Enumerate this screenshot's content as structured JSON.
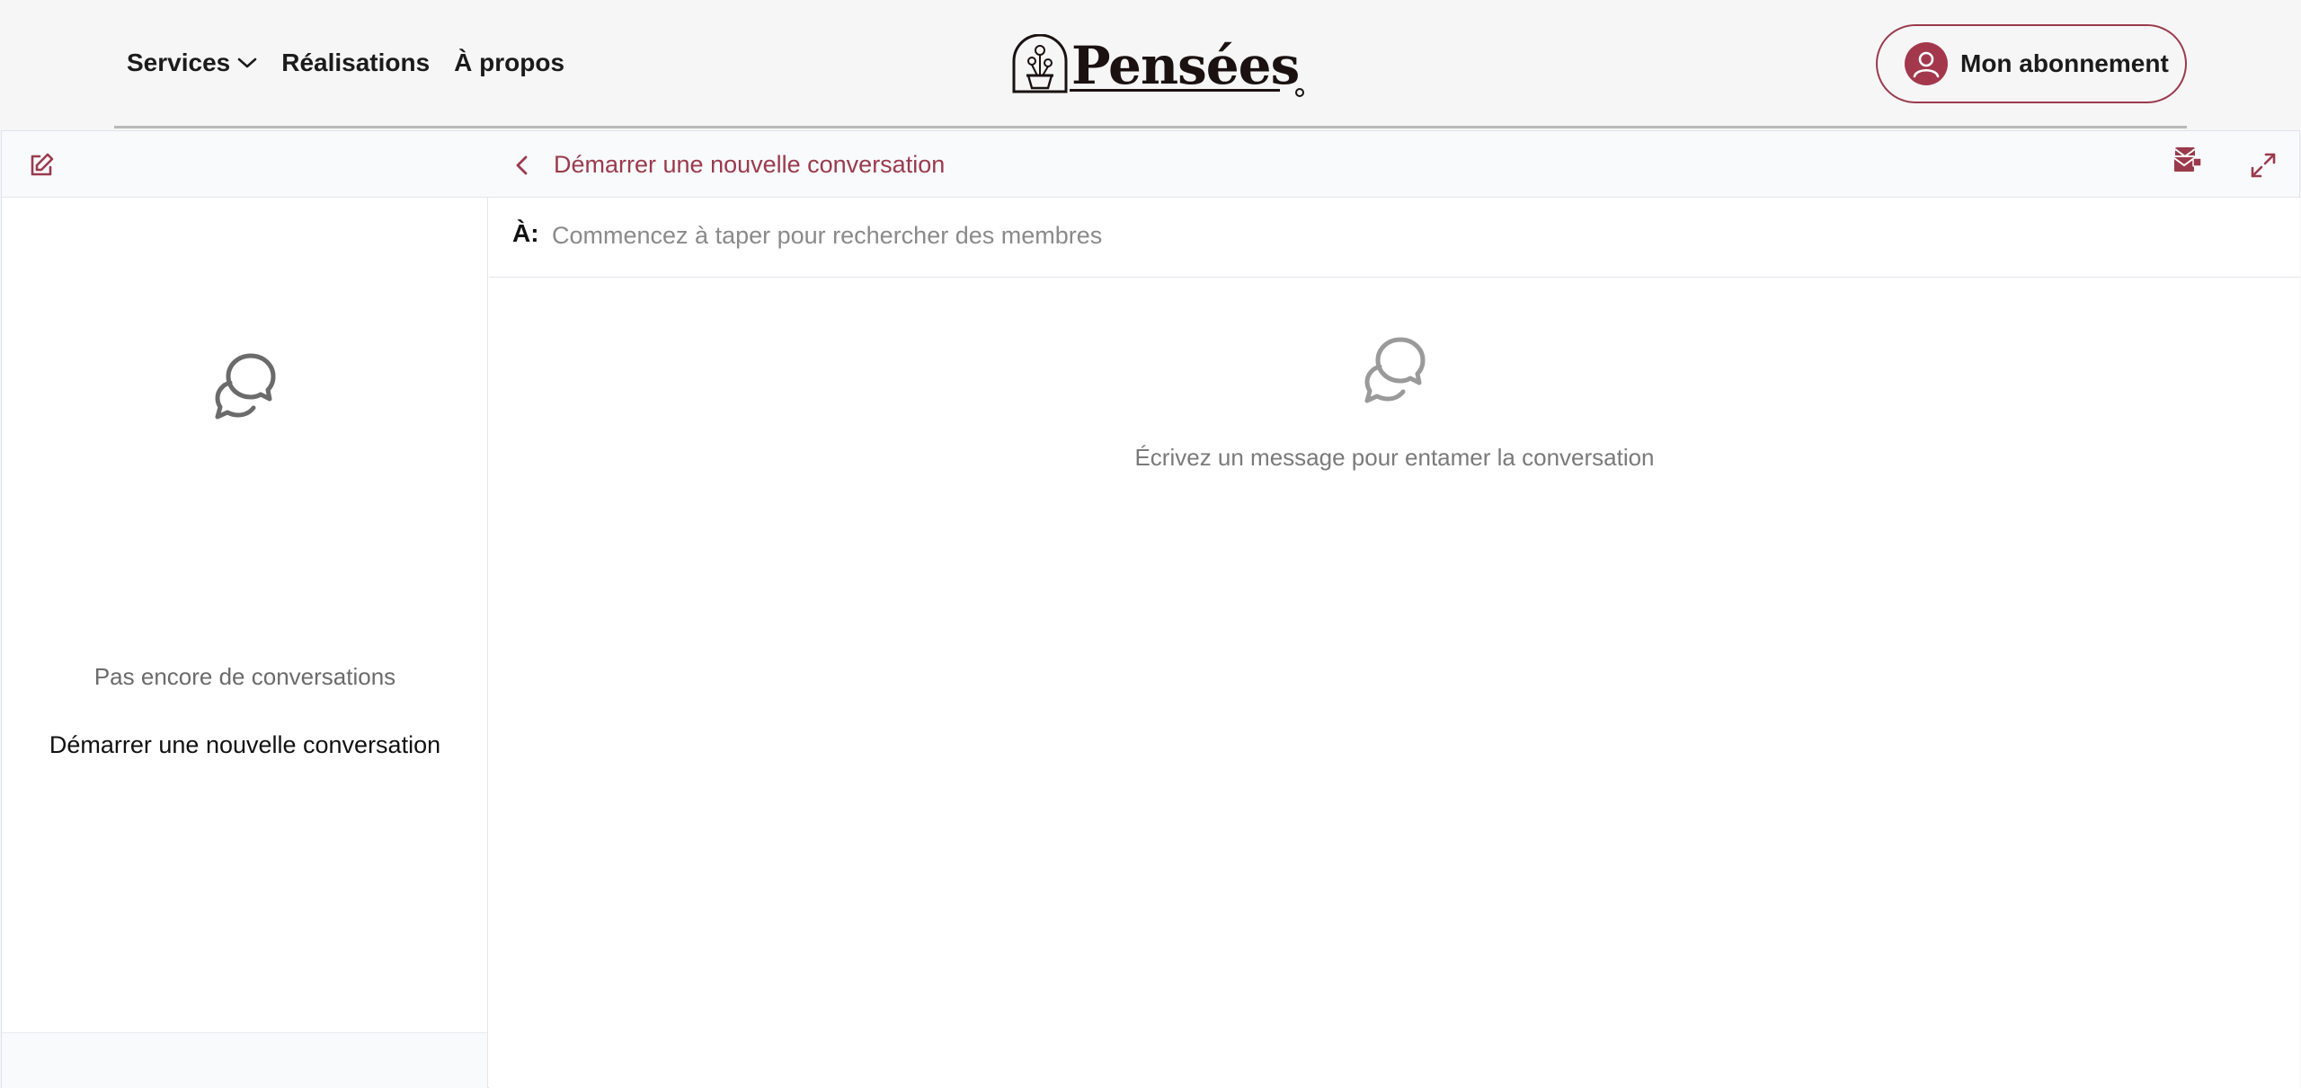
{
  "header": {
    "nav": [
      {
        "label": "Services",
        "has_dropdown": true
      },
      {
        "label": "Réalisations"
      },
      {
        "label": "À propos"
      }
    ],
    "logo_text": "Pensées",
    "subscription_label": "Mon abonnement"
  },
  "messaging": {
    "conversation_title": "Démarrer une nouvelle conversation",
    "to_label": "À:",
    "to_placeholder": "Commencez à taper pour rechercher des membres",
    "sidebar": {
      "empty_text": "Pas encore de conversations",
      "start_link": "Démarrer une nouvelle conversation"
    },
    "main_empty_text": "Écrivez un message pour entamer la conversation"
  },
  "icons": {
    "compose": "edit-icon",
    "back": "chevron-left-icon",
    "inbox": "inbox-icon",
    "expand": "expand-icon",
    "chat": "chat-bubbles-icon",
    "user": "user-icon"
  },
  "colors": {
    "accent": "#9b3a4c",
    "avatar": "#a3384c",
    "header_bg": "#f6f6f6",
    "panel_topbar": "#f8fafc"
  }
}
